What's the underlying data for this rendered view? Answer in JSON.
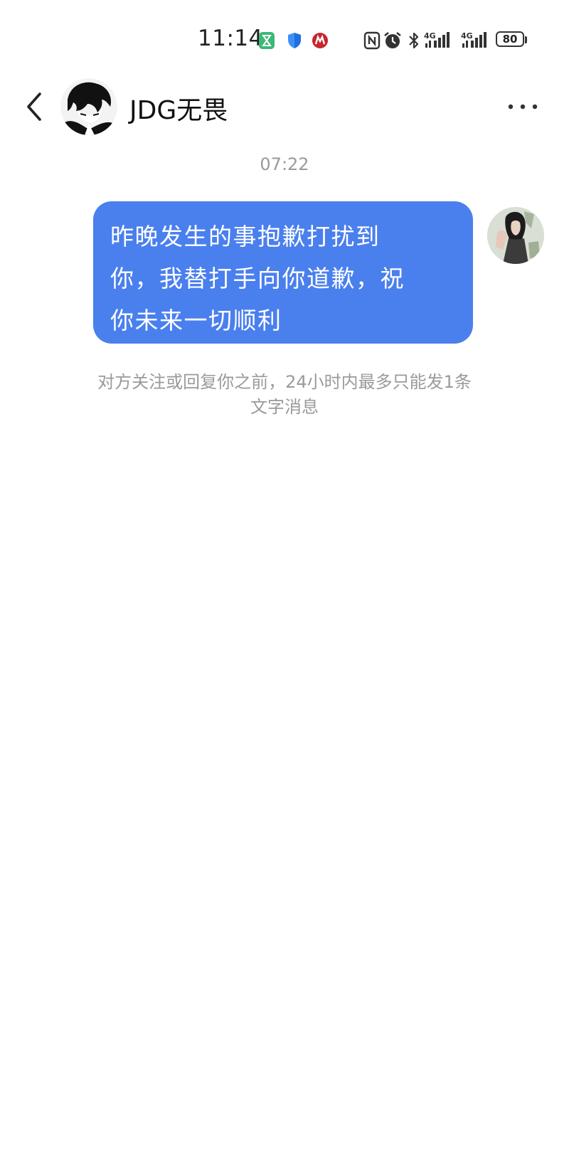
{
  "status_bar": {
    "time": "11:14",
    "battery": "80",
    "icons": [
      "hourglass-icon",
      "shield-icon",
      "bank-icon",
      "nfc-icon",
      "alarm-icon",
      "bluetooth-icon",
      "signal-4g-icon",
      "signal-4g-icon",
      "battery-icon"
    ],
    "signal_label": "4G"
  },
  "header": {
    "contact_name": "JDG无畏",
    "back_icon": "chevron-left-icon",
    "more_icon": "more-dots-icon"
  },
  "conversation": {
    "timestamp": "07:22",
    "messages": [
      {
        "sender": "self",
        "text": "昨晚发生的事抱歉打扰到\n你，我替打手向你道歉，祝\n你未来一切顺利"
      }
    ],
    "notice": "对方关注或回复你之前，24小时内最多只能发1条\n文字消息"
  },
  "colors": {
    "bubble": "#4a7fee",
    "bubble_text": "#ffffff",
    "muted_text": "#9a9a9a",
    "background": "#ffffff"
  }
}
